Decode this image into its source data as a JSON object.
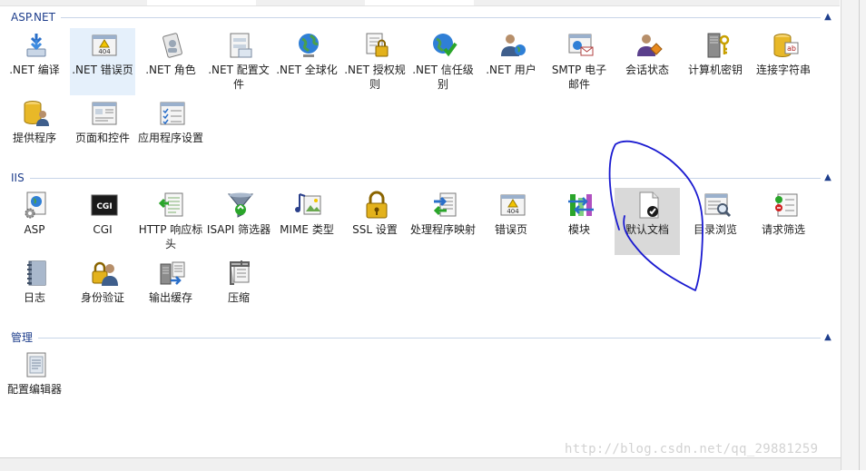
{
  "groups": {
    "aspnet": {
      "title": "ASP.NET",
      "items": [
        {
          "label": ".NET 编译",
          "icon": "download-arrows-icon"
        },
        {
          "label": ".NET 错误页",
          "icon": "error-404-icon"
        },
        {
          "label": ".NET 角色",
          "icon": "role-card-icon"
        },
        {
          "label": ".NET 配置文件",
          "icon": "profile-window-icon"
        },
        {
          "label": ".NET 全球化",
          "icon": "globe-icon"
        },
        {
          "label": ".NET 授权规则",
          "icon": "doc-lock-icon"
        },
        {
          "label": ".NET 信任级别",
          "icon": "globe-check-icon"
        },
        {
          "label": ".NET 用户",
          "icon": "user-globe-icon"
        },
        {
          "label": "SMTP 电子邮件",
          "icon": "email-window-icon"
        },
        {
          "label": "会话状态",
          "icon": "session-user-icon"
        },
        {
          "label": "计算机密钥",
          "icon": "server-key-icon"
        },
        {
          "label": "连接字符串",
          "icon": "database-ab-icon"
        },
        {
          "label": "提供程序",
          "icon": "database-users-icon"
        },
        {
          "label": "页面和控件",
          "icon": "page-controls-icon"
        },
        {
          "label": "应用程序设置",
          "icon": "checklist-icon"
        }
      ]
    },
    "iis": {
      "title": "IIS",
      "items": [
        {
          "label": "ASP",
          "icon": "asp-gear-icon"
        },
        {
          "label": "CGI",
          "icon": "cgi-terminal-icon"
        },
        {
          "label": "HTTP 响应标头",
          "icon": "http-header-icon"
        },
        {
          "label": "ISAPI 筛选器",
          "icon": "funnel-icon"
        },
        {
          "label": "MIME 类型",
          "icon": "mime-media-icon"
        },
        {
          "label": "SSL 设置",
          "icon": "padlock-icon"
        },
        {
          "label": "处理程序映射",
          "icon": "handler-mapping-icon"
        },
        {
          "label": "错误页",
          "icon": "error-page-icon"
        },
        {
          "label": "模块",
          "icon": "modules-icon"
        },
        {
          "label": "默认文档",
          "icon": "default-document-icon"
        },
        {
          "label": "目录浏览",
          "icon": "directory-browse-icon"
        },
        {
          "label": "请求筛选",
          "icon": "request-filter-icon"
        },
        {
          "label": "日志",
          "icon": "log-book-icon"
        },
        {
          "label": "身份验证",
          "icon": "auth-lock-user-icon"
        },
        {
          "label": "输出缓存",
          "icon": "output-cache-icon"
        },
        {
          "label": "压缩",
          "icon": "compress-vise-icon"
        }
      ]
    },
    "management": {
      "title": "管理",
      "items": [
        {
          "label": "配置编辑器",
          "icon": "config-editor-icon"
        }
      ]
    }
  },
  "watermark": "http://blog.csdn.net/qq_29881259",
  "colors": {
    "group_title": "#1e3e8c",
    "separator": "#c8d5e8",
    "selected_bg": "#e5f0fb",
    "focused_bg": "#d9d9d9",
    "annotation": "#1a1ad0"
  }
}
